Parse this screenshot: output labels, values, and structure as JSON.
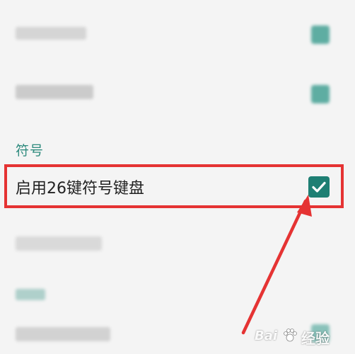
{
  "sections": {
    "symbol_header": "符号"
  },
  "settings": {
    "enable_26key_symbol_keyboard": {
      "label": "启用26键符号键盘",
      "checked": true
    }
  },
  "colors": {
    "accent": "#1e7f73",
    "highlight": "#e53333",
    "section_header": "#2f8b7e"
  },
  "watermark": {
    "brand": "Bai",
    "brand_suffix": "经验"
  },
  "icons": {
    "checkbox": "check-icon",
    "watermark_paw": "paw-icon"
  }
}
